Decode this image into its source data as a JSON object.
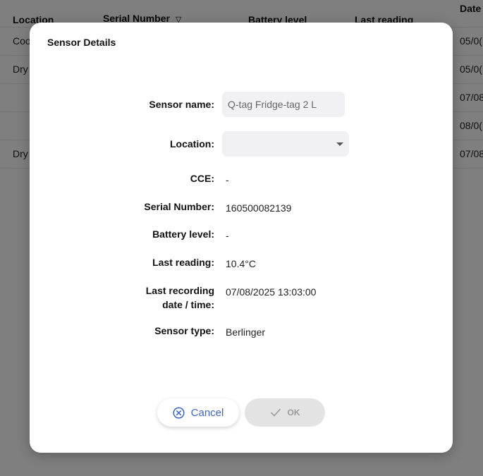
{
  "background_table": {
    "columns": [
      "Location",
      "Serial Number",
      "Battery level",
      "Last reading",
      "Date"
    ],
    "rows": [
      {
        "location": "Coo",
        "date": "05/0("
      },
      {
        "location": "Dry",
        "date": "05/0("
      },
      {
        "location": "",
        "date": "07/08"
      },
      {
        "location": "",
        "date": "08/0("
      },
      {
        "location": "Dry",
        "date": "07/08"
      }
    ]
  },
  "dialog": {
    "title": "Sensor Details",
    "fields": {
      "sensor_name_label": "Sensor name:",
      "sensor_name_value": "Q-tag Fridge-tag 2 L",
      "location_label": "Location:",
      "location_value": "",
      "cce_label": "CCE:",
      "cce_value": "-",
      "serial_label": "Serial Number:",
      "serial_value": "160500082139",
      "battery_label": "Battery level:",
      "battery_value": "-",
      "last_reading_label": "Last reading:",
      "last_reading_value": "10.4°C",
      "last_recording_label_line1": "Last recording",
      "last_recording_label_line2": "date / time:",
      "last_recording_value": "07/08/2025 13:03:00",
      "sensor_type_label": "Sensor type:",
      "sensor_type_value": "Berlinger"
    },
    "buttons": {
      "cancel": "Cancel",
      "ok": "OK"
    }
  },
  "colors": {
    "accent": "#3b63d6",
    "disabled_button": "#e3e3e3",
    "input_background": "#f1f1f3"
  },
  "icons": {
    "sort": "chevron-down-outline-icon",
    "cancel": "circle-x-icon",
    "ok": "check-icon",
    "dropdown": "caret-down-icon"
  }
}
